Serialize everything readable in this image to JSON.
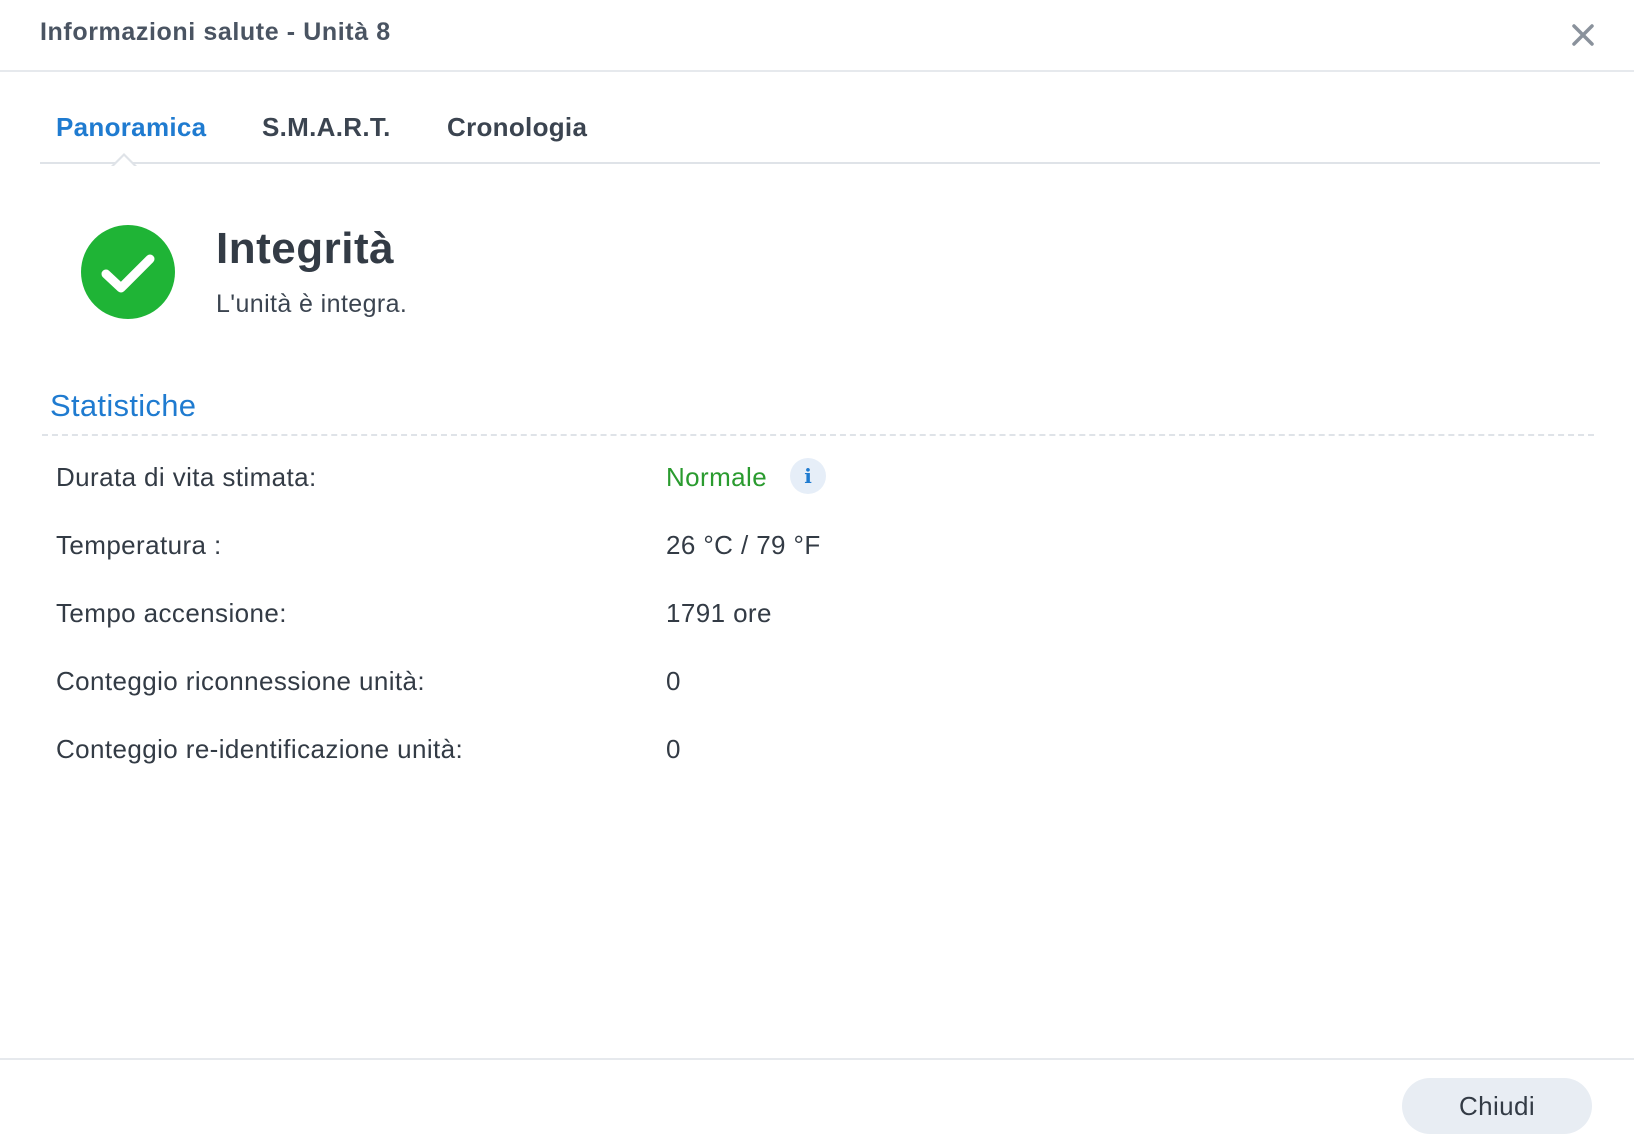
{
  "dialog": {
    "title": "Informazioni salute - Unità 8",
    "close_icon": "close-icon"
  },
  "tabs": [
    {
      "label": "Panoramica",
      "active": true
    },
    {
      "label": "S.M.A.R.T.",
      "active": false
    },
    {
      "label": "Cronologia",
      "active": false
    }
  ],
  "health": {
    "icon": "check-circle-icon",
    "icon_color": "#1fb436",
    "title": "Integrità",
    "description": "L'unità è integra."
  },
  "statistics": {
    "title": "Statistiche",
    "rows": [
      {
        "label": "Durata di vita stimata:",
        "value": "Normale",
        "value_color": "#2a9b2f",
        "info_icon": "info-icon"
      },
      {
        "label": "Temperatura :",
        "value": "26 °C / 79 °F"
      },
      {
        "label": "Tempo accensione:",
        "value": "1791 ore"
      },
      {
        "label": "Conteggio riconnessione unità:",
        "value": "0"
      },
      {
        "label": "Conteggio re-identificazione unità:",
        "value": "0"
      }
    ]
  },
  "footer": {
    "close_label": "Chiudi"
  },
  "colors": {
    "accent": "#1f7bd0",
    "success": "#1fb436"
  }
}
